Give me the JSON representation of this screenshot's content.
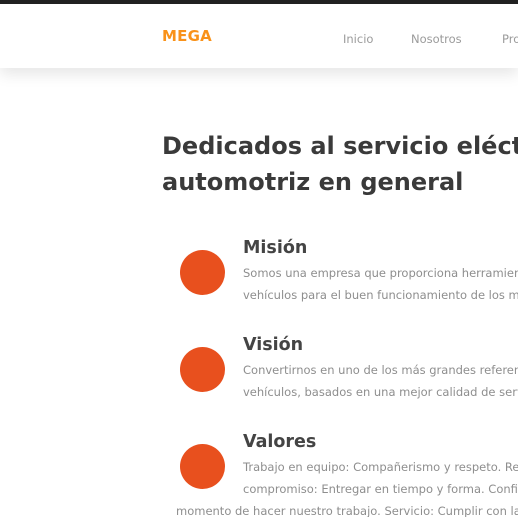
{
  "brand": "MEGA",
  "nav": {
    "items": [
      "Inicio",
      "Nosotros",
      "Pro"
    ]
  },
  "headline": {
    "line1": "Dedicados al servicio eléctrico",
    "line2": "automotriz en general"
  },
  "sections": [
    {
      "title": "Misión",
      "lines": [
        "Somos una empresa que proporciona herramient",
        "vehículos para el buen funcionamiento de los mis"
      ]
    },
    {
      "title": "Visión",
      "lines": [
        "Convertirnos en uno de los más grandes referent",
        "vehículos, basados en una mejor calidad de servic"
      ]
    },
    {
      "title": "Valores",
      "lines": [
        "Trabajo en equipo: Compañerismo y respeto. Res",
        "compromiso: Entregar en tiempo y forma. Confide",
        "momento de hacer nuestro trabajo. Servicio: Cumplir con las"
      ]
    }
  ],
  "colors": {
    "brand": "#f9921a",
    "accent_circle": "#e8501e",
    "topbar_border": "#212121",
    "heading": "#3a3a3a",
    "body_text": "#8e8e8e",
    "nav_text": "#9b9b9b"
  },
  "icons": [
    "mision-icon",
    "vision-icon",
    "valores-icon"
  ]
}
